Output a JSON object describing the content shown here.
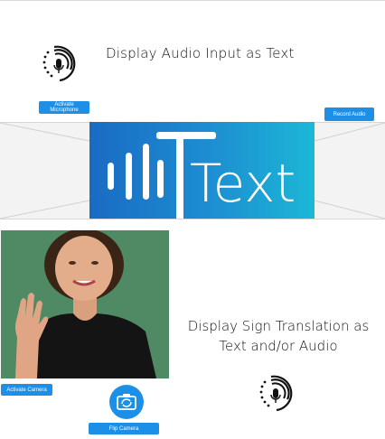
{
  "audio_section": {
    "heading": "Display Audio Input as Text",
    "activate_mic_label": "Activate Microphone",
    "record_audio_label": "Record Audio"
  },
  "banner": {
    "logo_text": "Text"
  },
  "sign_section": {
    "heading_line1": "Display Sign Translation as",
    "heading_line2": "Text and/or Audio",
    "activate_camera_label": "Activate Camera",
    "flip_camera_label": "Flip Camera"
  },
  "icons": {
    "audio_mic": "microphone-sound-icon",
    "sign_mic": "microphone-sound-icon",
    "camera_flip": "camera-flip-icon"
  },
  "colors": {
    "button_blue": "#1e8fe6",
    "banner_gradient_start": "#1a6bc3",
    "banner_gradient_end": "#1cb7d6"
  }
}
